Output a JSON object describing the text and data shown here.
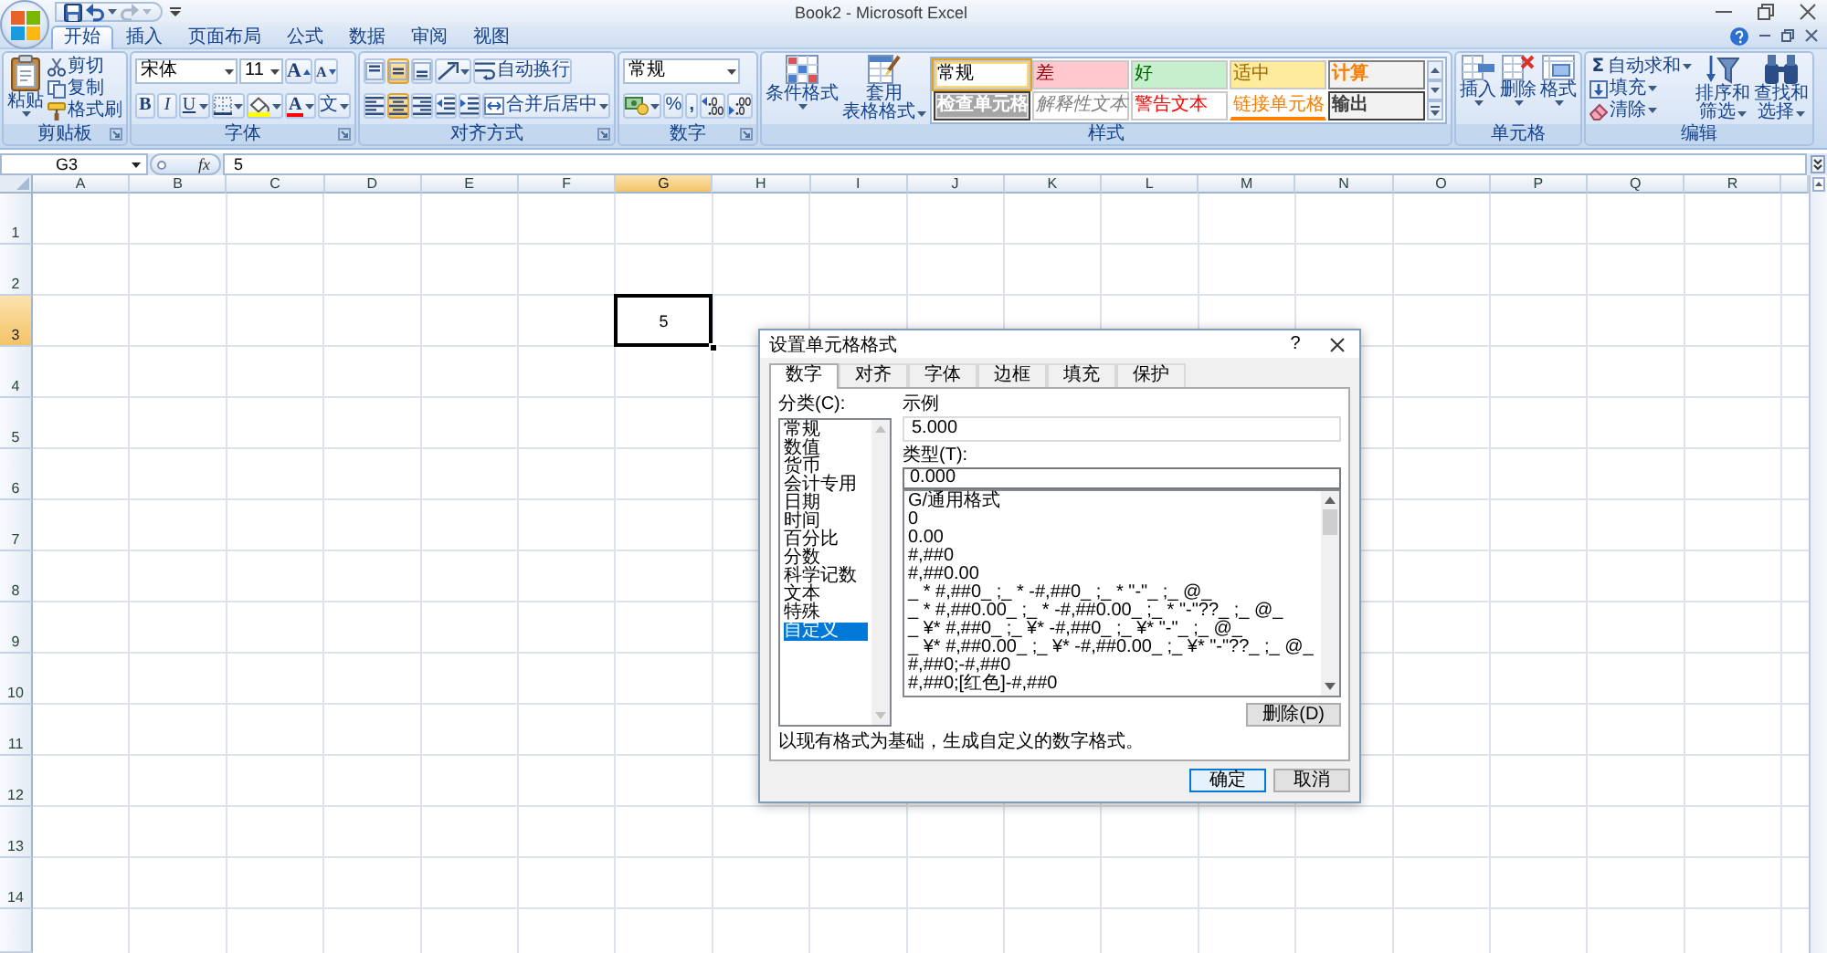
{
  "window": {
    "title": "Book2 - Microsoft Excel"
  },
  "quick_access": [
    {
      "kind": "save",
      "disabled": false
    },
    {
      "kind": "undo",
      "disabled": false
    },
    {
      "kind": "redo",
      "disabled": true
    }
  ],
  "tabs": [
    {
      "label": "开始",
      "selected": true
    },
    {
      "label": "插入",
      "selected": false
    },
    {
      "label": "页面布局",
      "selected": false
    },
    {
      "label": "公式",
      "selected": false
    },
    {
      "label": "数据",
      "selected": false
    },
    {
      "label": "审阅",
      "selected": false
    },
    {
      "label": "视图",
      "selected": false
    }
  ],
  "ribbon": {
    "clipboard": {
      "label": "剪贴板",
      "paste": "粘贴",
      "commands": [
        {
          "kind": "cut",
          "label": "剪切"
        },
        {
          "kind": "copy",
          "label": "复制"
        },
        {
          "kind": "painter",
          "label": "格式刷"
        }
      ]
    },
    "font": {
      "label": "字体",
      "font_name": "宋体",
      "font_size": "11",
      "grow": "A",
      "shrink": "A",
      "bold": "B",
      "italic": "I",
      "underline": "U",
      "font_color": "A",
      "phonetic": "文"
    },
    "alignment": {
      "label": "对齐方式",
      "vertical": [
        {
          "kind": "top",
          "selected": false
        },
        {
          "kind": "middle",
          "selected": true
        },
        {
          "kind": "bottom",
          "selected": false
        }
      ],
      "horizontal": [
        {
          "kind": "left",
          "selected": false
        },
        {
          "kind": "center",
          "selected": true
        },
        {
          "kind": "right",
          "selected": false
        }
      ],
      "wrap_text": "自动换行",
      "merge_center": "合并后居中"
    },
    "number": {
      "label": "数字",
      "format": "常规",
      "percent": "%",
      "comma": ","
    },
    "styles": {
      "label": "样式",
      "conditional": "条件格式",
      "table_format": [
        "套用",
        "表格格式"
      ],
      "cell_styles": [
        {
          "kind": "normal",
          "label": "常规",
          "selected": true
        },
        {
          "kind": "bad",
          "label": "差",
          "selected": false
        },
        {
          "kind": "good",
          "label": "好",
          "selected": false
        },
        {
          "kind": "neutral",
          "label": "适中",
          "selected": false
        },
        {
          "kind": "calculation",
          "label": "计算",
          "selected": false
        },
        {
          "kind": "check",
          "label": "检查单元格",
          "selected": false
        },
        {
          "kind": "explanatory",
          "label": "解释性文本",
          "selected": false
        },
        {
          "kind": "warning",
          "label": "警告文本",
          "selected": false
        },
        {
          "kind": "linked",
          "label": "链接单元格",
          "selected": false
        },
        {
          "kind": "output",
          "label": "输出",
          "selected": false
        }
      ]
    },
    "cells": {
      "label": "单元格",
      "commands": [
        {
          "kind": "insert",
          "label": "插入"
        },
        {
          "kind": "delete",
          "label": "删除"
        },
        {
          "kind": "format",
          "label": "格式"
        }
      ]
    },
    "editing": {
      "label": "编辑",
      "commands": [
        {
          "kind": "autosum",
          "symbol": "Σ",
          "label": "自动求和"
        },
        {
          "kind": "fill",
          "label": "填充"
        },
        {
          "kind": "clear",
          "label": "清除"
        }
      ],
      "sort_filter": [
        "排序和",
        "筛选"
      ],
      "find_select": [
        "查找和",
        "选择"
      ]
    }
  },
  "formula_bar": {
    "name_box": "G3",
    "function_button": "fx",
    "value": "5"
  },
  "sheet": {
    "columns": [
      {
        "label": "A",
        "selected": false
      },
      {
        "label": "B",
        "selected": false
      },
      {
        "label": "C",
        "selected": false
      },
      {
        "label": "D",
        "selected": false
      },
      {
        "label": "E",
        "selected": false
      },
      {
        "label": "F",
        "selected": false
      },
      {
        "label": "G",
        "selected": true
      },
      {
        "label": "H",
        "selected": false
      },
      {
        "label": "I",
        "selected": false
      },
      {
        "label": "J",
        "selected": false
      },
      {
        "label": "K",
        "selected": false
      },
      {
        "label": "L",
        "selected": false
      },
      {
        "label": "M",
        "selected": false
      },
      {
        "label": "N",
        "selected": false
      },
      {
        "label": "O",
        "selected": false
      },
      {
        "label": "P",
        "selected": false
      },
      {
        "label": "Q",
        "selected": false
      },
      {
        "label": "R",
        "selected": false
      }
    ],
    "rows": [
      {
        "label": "1",
        "selected": false
      },
      {
        "label": "2",
        "selected": false
      },
      {
        "label": "3",
        "selected": true
      },
      {
        "label": "4",
        "selected": false
      },
      {
        "label": "5",
        "selected": false
      },
      {
        "label": "6",
        "selected": false
      },
      {
        "label": "7",
        "selected": false
      },
      {
        "label": "8",
        "selected": false
      },
      {
        "label": "9",
        "selected": false
      },
      {
        "label": "10",
        "selected": false
      },
      {
        "label": "11",
        "selected": false
      },
      {
        "label": "12",
        "selected": false
      },
      {
        "label": "13",
        "selected": false
      },
      {
        "label": "14",
        "selected": false
      }
    ],
    "active_cell": {
      "value": "5"
    }
  },
  "dialog": {
    "title": "设置单元格格式",
    "help": "?",
    "tabs": [
      {
        "label": "数字",
        "selected": true
      },
      {
        "label": "对齐",
        "selected": false
      },
      {
        "label": "字体",
        "selected": false
      },
      {
        "label": "边框",
        "selected": false
      },
      {
        "label": "填充",
        "selected": false
      },
      {
        "label": "保护",
        "selected": false
      }
    ],
    "category_label": "分类(C):",
    "categories": [
      {
        "label": "常规",
        "selected": false
      },
      {
        "label": "数值",
        "selected": false
      },
      {
        "label": "货币",
        "selected": false
      },
      {
        "label": "会计专用",
        "selected": false
      },
      {
        "label": "日期",
        "selected": false
      },
      {
        "label": "时间",
        "selected": false
      },
      {
        "label": "百分比",
        "selected": false
      },
      {
        "label": "分数",
        "selected": false
      },
      {
        "label": "科学记数",
        "selected": false
      },
      {
        "label": "文本",
        "selected": false
      },
      {
        "label": "特殊",
        "selected": false
      },
      {
        "label": "自定义",
        "selected": true
      }
    ],
    "sample_label": "示例",
    "sample": "5.000",
    "type_label": "类型(T):",
    "type_value": "0.000",
    "formats": [
      "G/通用格式",
      "0",
      "0.00",
      "#,##0",
      "#,##0.00",
      "_ * #,##0_ ;_ * -#,##0_ ;_ * \"-\"_ ;_ @_",
      "_ * #,##0.00_ ;_ * -#,##0.00_ ;_ * \"-\"??_ ;_ @_",
      "_ ¥* #,##0_ ;_ ¥* -#,##0_ ;_ ¥* \"-\"_ ;_ @_",
      "_ ¥* #,##0.00_ ;_ ¥* -#,##0.00_ ;_ ¥* \"-\"??_ ;_ @_",
      "#,##0;-#,##0",
      "#,##0;[红色]-#,##0"
    ],
    "delete_button": "删除(D)",
    "description": "以现有格式为基础，生成自定义的数字格式。",
    "buttons": [
      {
        "label": "确定",
        "focused": true
      },
      {
        "label": "取消",
        "focused": false
      }
    ]
  }
}
